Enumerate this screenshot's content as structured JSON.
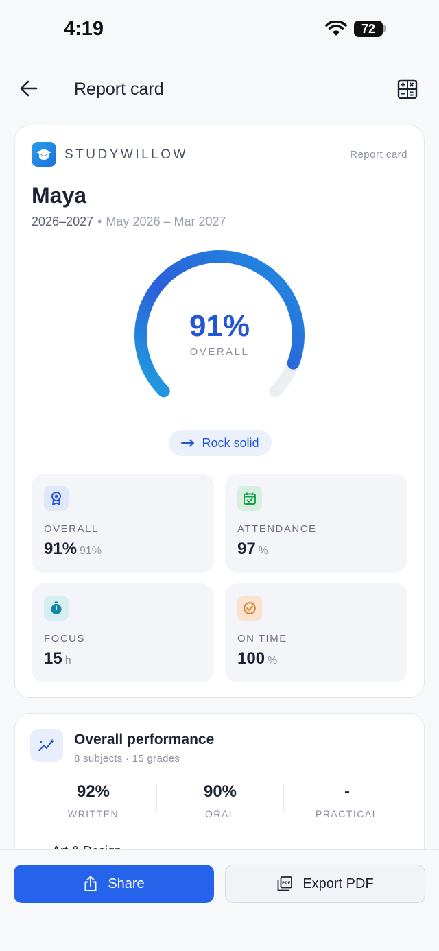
{
  "status_bar": {
    "time": "4:19",
    "battery": "72"
  },
  "header": {
    "title": "Report card"
  },
  "card": {
    "brand": "STUDYWILLOW",
    "tag": "Report card",
    "student": "Maya",
    "year": "2026–2027",
    "range": "May 2026 – Mar 2027",
    "gauge": {
      "value_text": "91%",
      "label": "OVERALL",
      "fraction": 0.91
    },
    "trend": "Rock solid",
    "tiles": [
      {
        "label": "OVERALL",
        "value": "91%",
        "unit": "91%",
        "icon": "award-icon"
      },
      {
        "label": "ATTENDANCE",
        "value": "97",
        "unit": "%",
        "icon": "calendar-check-icon"
      },
      {
        "label": "FOCUS",
        "value": "15",
        "unit": "h",
        "icon": "stopwatch-icon"
      },
      {
        "label": "ON TIME",
        "value": "100",
        "unit": "%",
        "icon": "check-circle-icon"
      }
    ],
    "colors": {
      "accent": "#2563eb",
      "gauge_start": "#1fa0e0",
      "gauge_end": "#2b5fd9"
    }
  },
  "performance": {
    "title": "Overall performance",
    "subtitle": "8 subjects · 15 grades",
    "stats": [
      {
        "value": "92%",
        "label": "WRITTEN"
      },
      {
        "value": "90%",
        "label": "ORAL"
      },
      {
        "value": "-",
        "label": "PRACTICAL"
      }
    ],
    "first_row": "Art & Design"
  },
  "actions": {
    "share": "Share",
    "export": "Export PDF"
  }
}
